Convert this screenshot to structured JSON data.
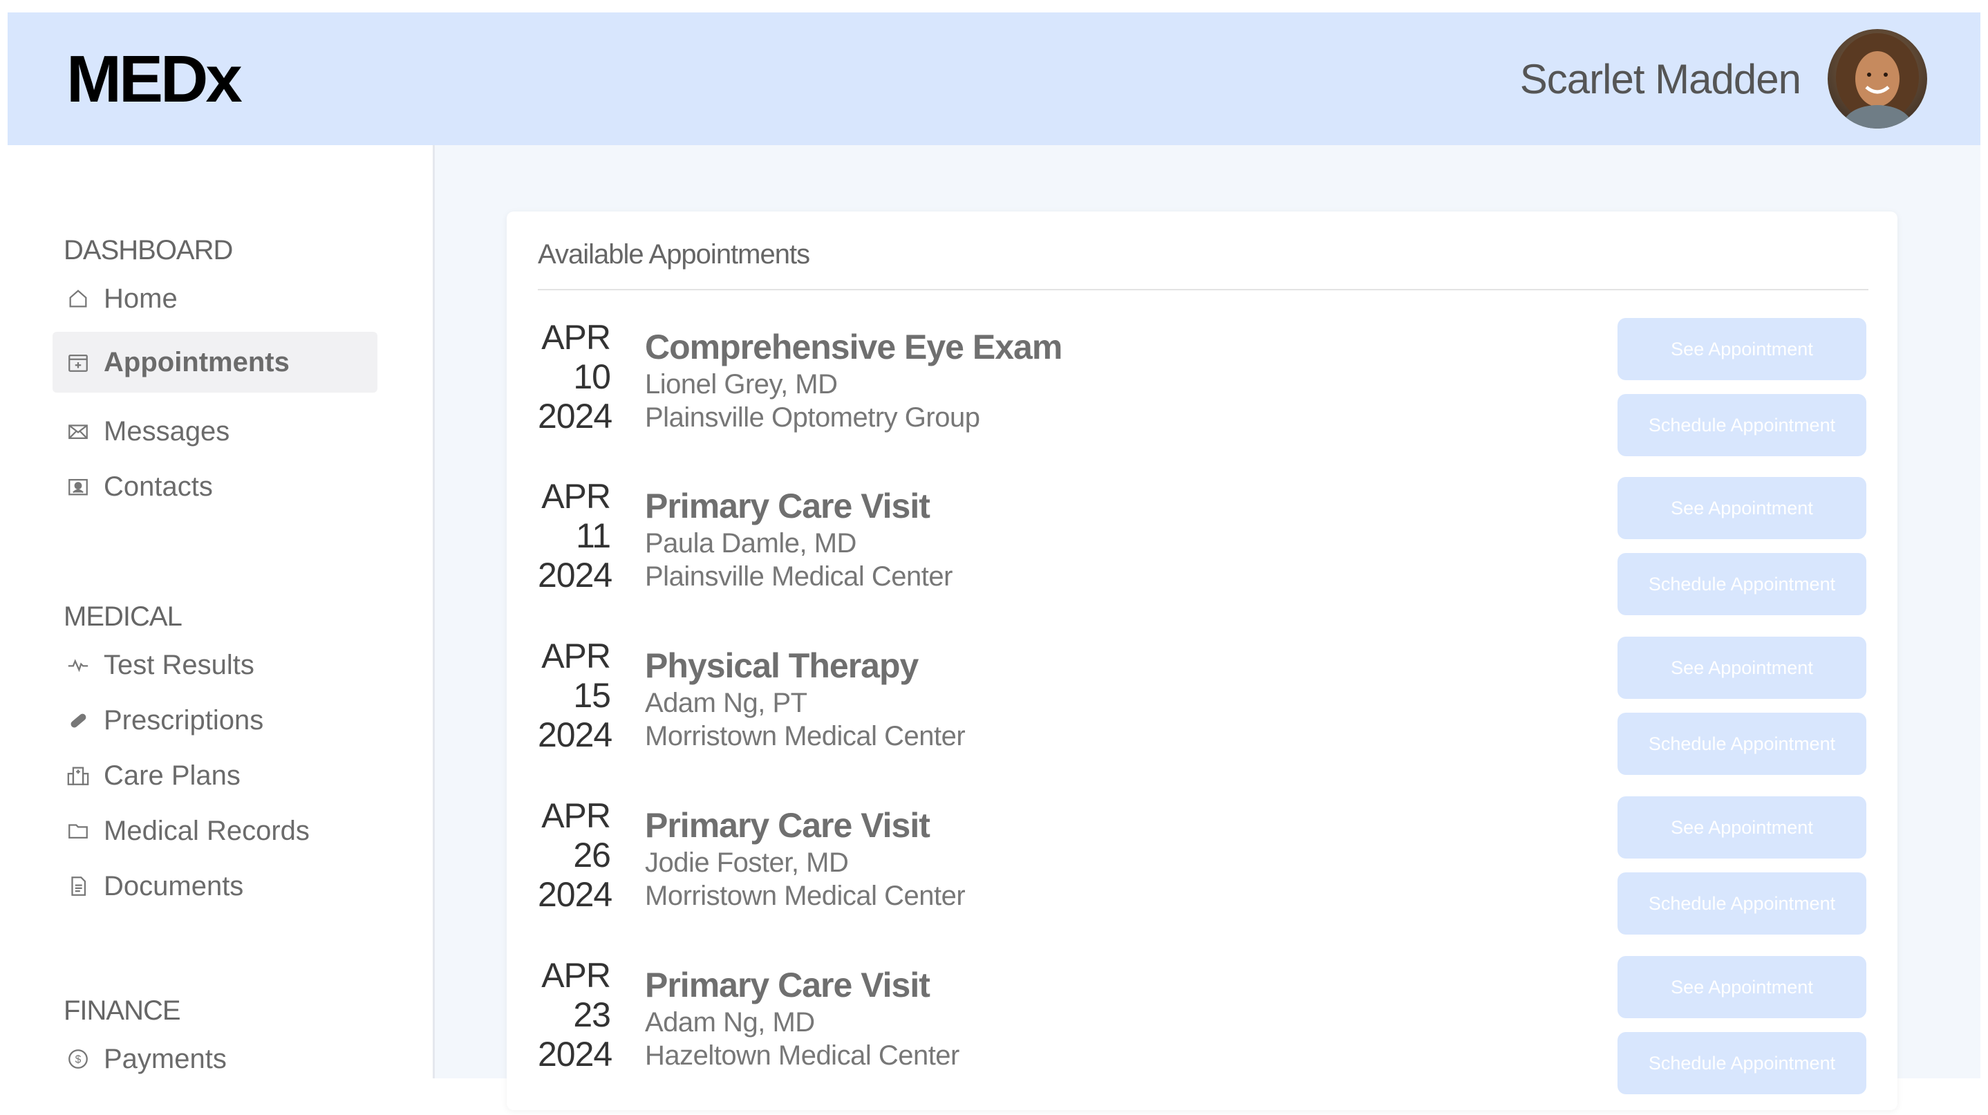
{
  "app": {
    "logo": "MEDx",
    "user_name": "Scarlet Madden",
    "accent": "#d8e6fd"
  },
  "sidebar": {
    "sections": [
      {
        "title": "DASHBOARD",
        "items": [
          {
            "label": "Home",
            "icon": "home-icon"
          },
          {
            "label": "Appointments",
            "icon": "calendar-icon",
            "active": true
          },
          {
            "label": "Messages",
            "icon": "envelope-icon"
          },
          {
            "label": "Contacts",
            "icon": "contact-card-icon"
          }
        ]
      },
      {
        "title": "MEDICAL",
        "items": [
          {
            "label": "Test Results",
            "icon": "pulse-icon"
          },
          {
            "label": "Prescriptions",
            "icon": "pill-icon"
          },
          {
            "label": "Care Plans",
            "icon": "hospital-icon"
          },
          {
            "label": "Medical Records",
            "icon": "folder-icon"
          },
          {
            "label": "Documents",
            "icon": "document-icon"
          }
        ]
      },
      {
        "title": "FINANCE",
        "items": [
          {
            "label": "Payments",
            "icon": "dollar-coin-icon"
          }
        ]
      }
    ]
  },
  "appointments": {
    "title": "Available Appointments",
    "see_label": "See Appointment",
    "schedule_label": "Schedule Appointment",
    "items": [
      {
        "month": "APR",
        "day": "10",
        "year": "2024",
        "title": "Comprehensive Eye Exam",
        "provider": "Lionel Grey, MD",
        "location": "Plainsville Optometry Group"
      },
      {
        "month": "APR",
        "day": "11",
        "year": "2024",
        "title": "Primary Care Visit",
        "provider": "Paula Damle, MD",
        "location": "Plainsville Medical Center"
      },
      {
        "month": "APR",
        "day": "15",
        "year": "2024",
        "title": "Physical Therapy",
        "provider": "Adam Ng, PT",
        "location": "Morristown Medical Center"
      },
      {
        "month": "APR",
        "day": "26",
        "year": "2024",
        "title": "Primary Care Visit",
        "provider": "Jodie Foster, MD",
        "location": "Morristown Medical Center"
      },
      {
        "month": "APR",
        "day": "23",
        "year": "2024",
        "title": "Primary Care Visit",
        "provider": "Adam Ng, MD",
        "location": "Hazeltown Medical Center"
      }
    ]
  }
}
